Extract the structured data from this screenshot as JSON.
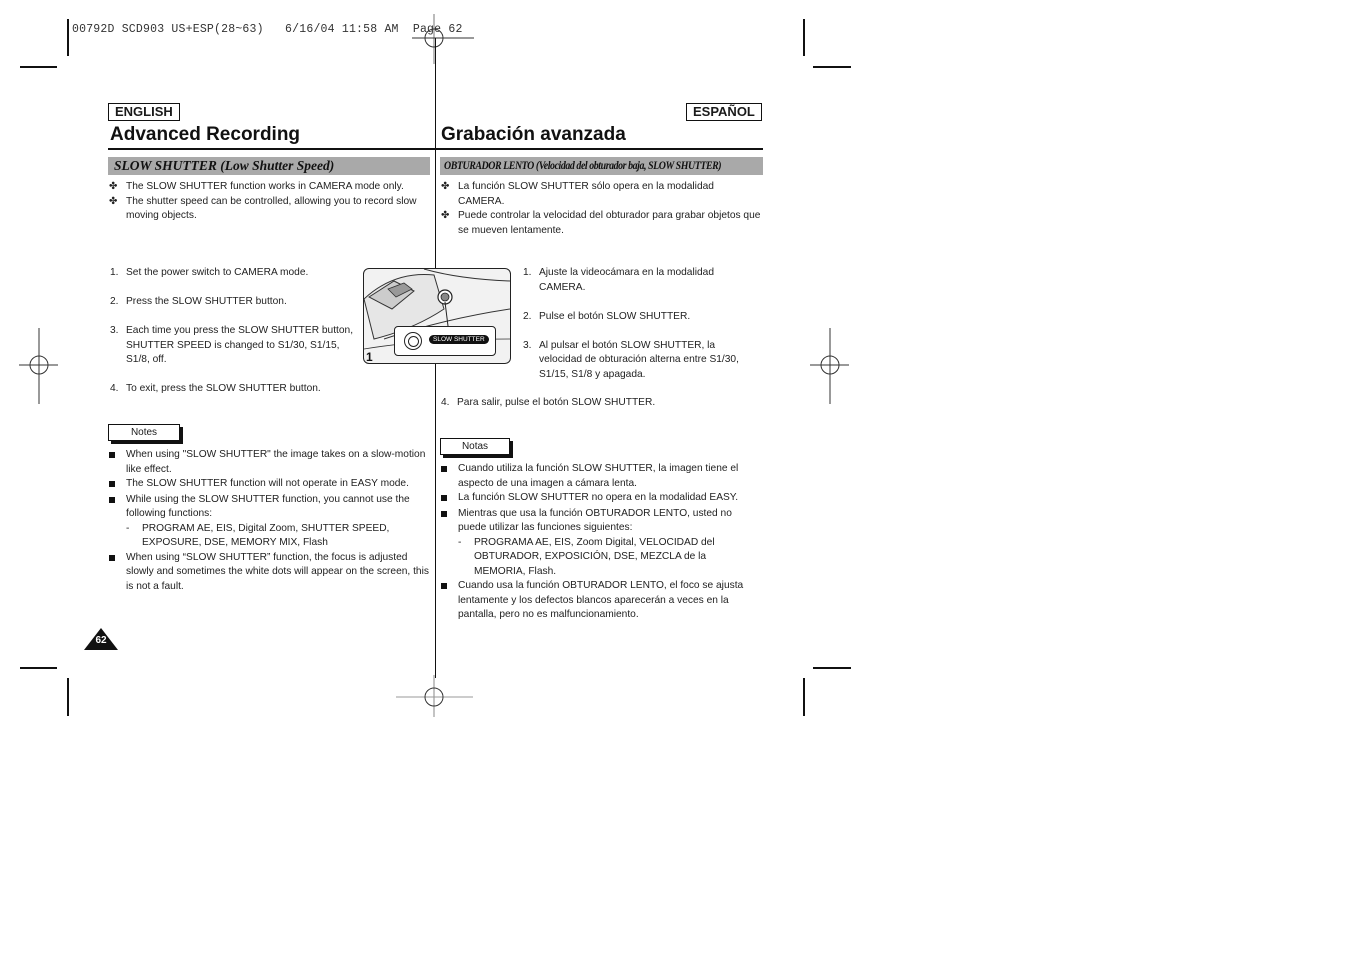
{
  "print_slug": "00792D SCD903 US+ESP(28~63)   6/16/04 11:58 AM  Page 62",
  "english": {
    "lang_label": "ENGLISH",
    "title": "Advanced Recording",
    "section_title": "SLOW SHUTTER (Low Shutter Speed)",
    "intro": [
      "The SLOW SHUTTER function works in CAMERA mode only.",
      "The shutter speed can be controlled, allowing you to record slow moving objects."
    ],
    "steps": [
      {
        "n": "1.",
        "text": "Set the power switch to CAMERA mode."
      },
      {
        "n": "2.",
        "text": "Press the SLOW SHUTTER button."
      },
      {
        "n": "3.",
        "text": "Each time you press the SLOW SHUTTER button, SHUTTER SPEED is changed to S1/30, S1/15, S1/8, off."
      },
      {
        "n": "4.",
        "text": "To exit, press the SLOW SHUTTER button."
      }
    ],
    "notes_label": "Notes",
    "notes": [
      "When using \"SLOW SHUTTER\" the image takes on a slow-motion like effect.",
      "The SLOW SHUTTER function will not operate in EASY mode.",
      "While using the SLOW SHUTTER function, you cannot use the following functions:",
      "When using “SLOW SHUTTER” function, the focus is adjusted slowly and sometimes the white dots will appear on the screen, this is not a fault."
    ],
    "notes_sub": "PROGRAM AE, EIS, Digital Zoom, SHUTTER SPEED, EXPOSURE, DSE, MEMORY MIX, Flash"
  },
  "espanol": {
    "lang_label": "ESPAÑOL",
    "title": "Grabación avanzada",
    "section_title": "OBTURADOR LENTO (Velocidad del obturador baja, SLOW SHUTTER)",
    "intro": [
      "La función SLOW SHUTTER sólo opera en la modalidad CAMERA.",
      "Puede controlar la velocidad del obturador para grabar objetos que se mueven lentamente."
    ],
    "steps": [
      {
        "n": "1.",
        "text": "Ajuste la videocámara en la modalidad CAMERA."
      },
      {
        "n": "2.",
        "text": "Pulse el botón SLOW SHUTTER."
      },
      {
        "n": "3.",
        "text": "Al pulsar el botón SLOW SHUTTER, la velocidad de obturación alterna entre S1/30, S1/15, S1/8 y apagada."
      },
      {
        "n": "4.",
        "text": "Para salir, pulse el botón SLOW SHUTTER."
      }
    ],
    "notes_label": "Notas",
    "notes": [
      "Cuando utiliza la función SLOW SHUTTER, la imagen tiene el aspecto de una imagen a cámara lenta.",
      "La función SLOW SHUTTER no opera en la modalidad EASY.",
      "Mientras que usa la función OBTURADOR LENTO, usted no puede utilizar las funciones siguientes:",
      "Cuando usa la función OBTURADOR LENTO, el foco se ajusta lentamente y los defectos blancos aparecerán a veces en la pantalla, pero no es malfuncionamiento."
    ],
    "notes_sub": "PROGRAMA AE, EIS, Zoom Digital, VELOCIDAD del OBTURADOR, EXPOSICIÓN, DSE, MEZCLA de la MEMORIA, Flash."
  },
  "illustration": {
    "button_label": "SLOW SHUTTER",
    "step_marker": "1"
  },
  "page_number": "62",
  "bullet_glyph": "✤"
}
